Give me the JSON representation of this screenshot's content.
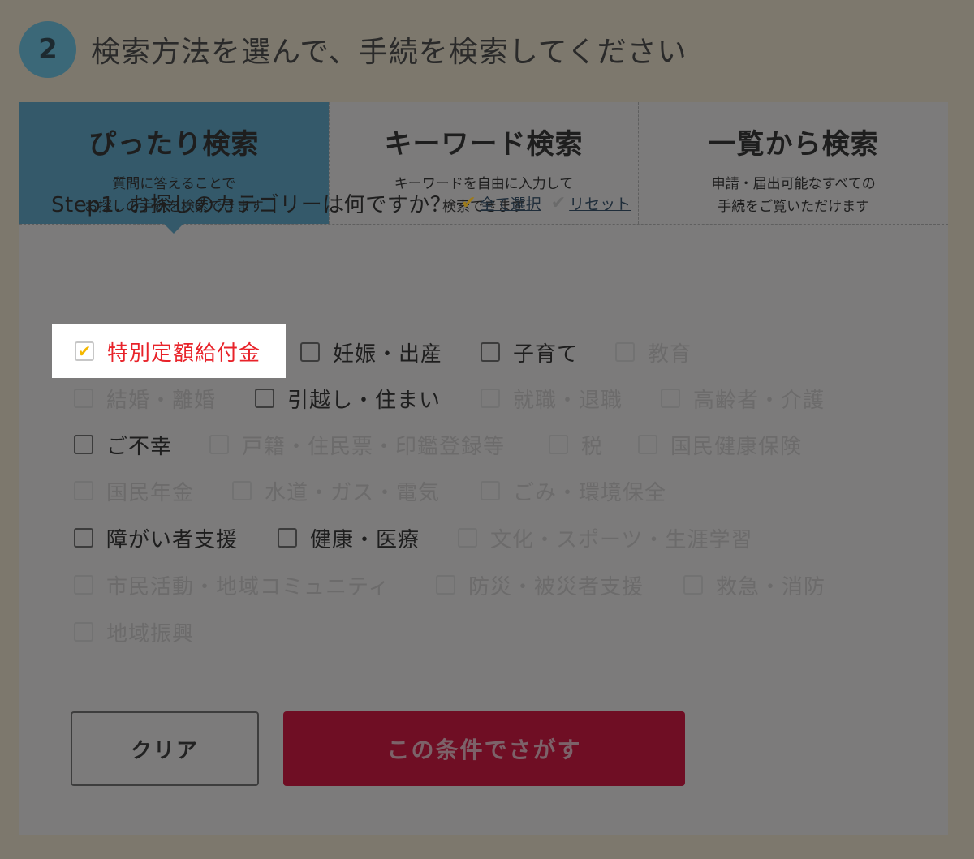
{
  "header": {
    "step_number": "2",
    "title": "検索方法を選んで、手続を検索してください"
  },
  "tabs": [
    {
      "title": "ぴったり検索",
      "desc1": "質問に答えることで",
      "desc2": "お探しの手続を検索できます"
    },
    {
      "title": "キーワード検索",
      "desc1": "キーワードを自由に入力して",
      "desc2": "検索できます"
    },
    {
      "title": "一覧から検索",
      "desc1": "申請・届出可能なすべての",
      "desc2": "手続をご覧いただけます"
    }
  ],
  "step1": {
    "label": "Step1. お探しのカテゴリーは何ですか？",
    "select_all": "全て選択",
    "reset": "リセット"
  },
  "categories": [
    "特別定額給付金",
    "妊娠・出産",
    "子育て",
    "教育",
    "結婚・離婚",
    "引越し・住まい",
    "就職・退職",
    "高齢者・介護",
    "ご不幸",
    "戸籍・住民票・印鑑登録等",
    "税",
    "国民健康保険",
    "国民年金",
    "水道・ガス・電気",
    "ごみ・環境保全",
    "障がい者支援",
    "健康・医療",
    "文化・スポーツ・生涯学習",
    "市民活動・地域コミュニティ",
    "防災・被災者支援",
    "救急・消防",
    "地域振興"
  ],
  "buttons": {
    "clear": "クリア",
    "search": "この条件でさがす"
  },
  "colors": {
    "active_tab": "#34596a",
    "checked_label": "#e8232a",
    "check_tick": "#f5b800",
    "search_button": "#6f0e24"
  }
}
